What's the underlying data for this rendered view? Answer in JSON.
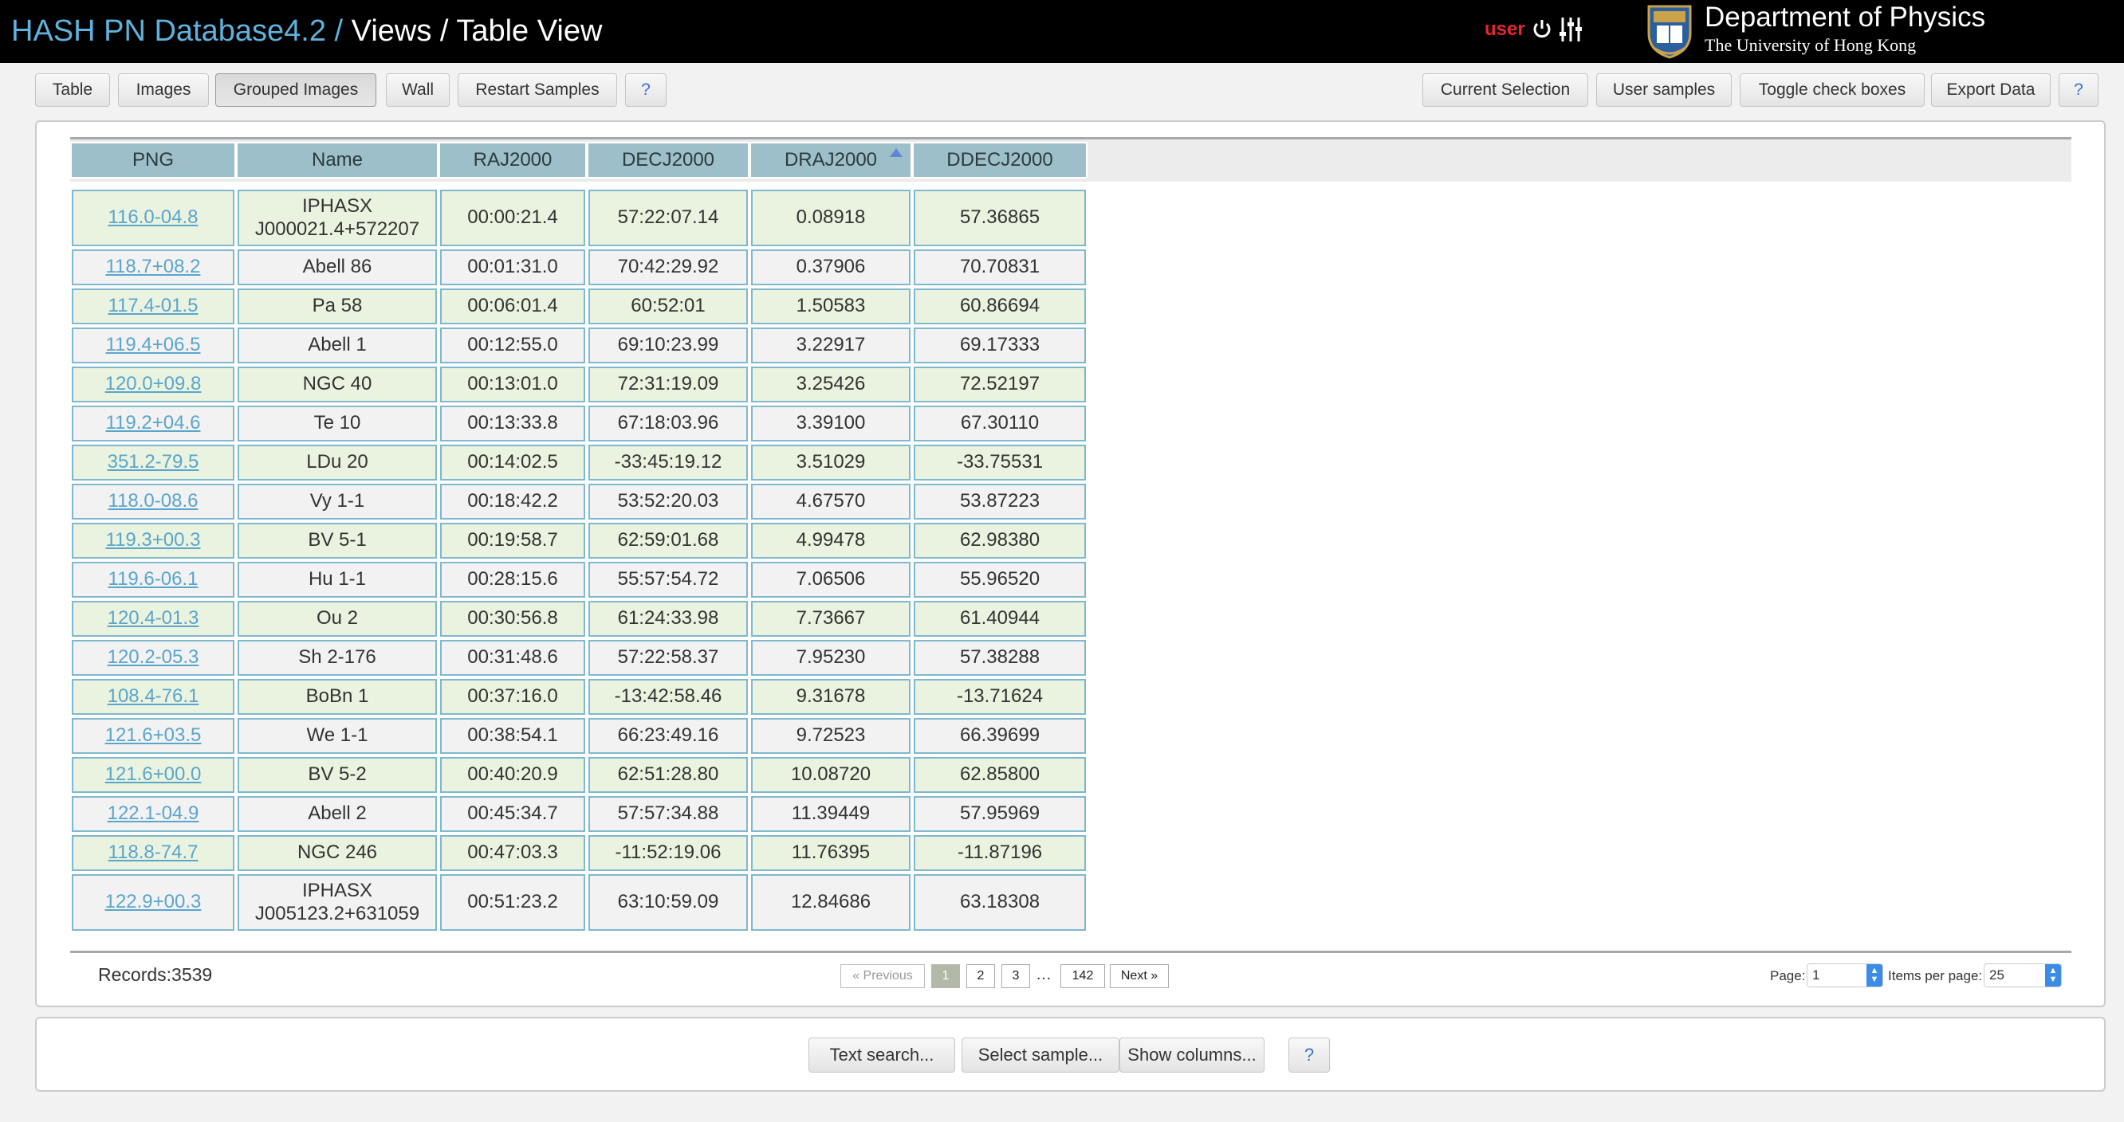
{
  "header": {
    "title_prefix": "HASH PN Database4.2 /",
    "title_suffix": "Views / Table View",
    "user_label": "user",
    "dept_name": "Department of Physics",
    "uni_name": "The University of Hong Kong"
  },
  "toolbar_left": [
    "Table",
    "Images",
    "Grouped Images",
    "Wall",
    "Restart Samples",
    "?"
  ],
  "active_view": "Grouped Images",
  "toolbar_right": [
    "Current Selection",
    "User samples",
    "Toggle check boxes",
    "Export Data",
    "?"
  ],
  "table": {
    "columns": [
      "PNG",
      "Name",
      "RAJ2000",
      "DECJ2000",
      "DRAJ2000",
      "DDECJ2000"
    ],
    "sorted_column": "DRAJ2000",
    "sort_direction": "ascending",
    "rows": [
      [
        "116.0-04.8",
        "IPHASX\nJ000021.4+572207",
        "00:00:21.4",
        "57:22:07.14",
        "0.08918",
        "57.36865"
      ],
      [
        "118.7+08.2",
        "Abell 86",
        "00:01:31.0",
        "70:42:29.92",
        "0.37906",
        "70.70831"
      ],
      [
        "117.4-01.5",
        "Pa 58",
        "00:06:01.4",
        "60:52:01",
        "1.50583",
        "60.86694"
      ],
      [
        "119.4+06.5",
        "Abell 1",
        "00:12:55.0",
        "69:10:23.99",
        "3.22917",
        "69.17333"
      ],
      [
        "120.0+09.8",
        "NGC 40",
        "00:13:01.0",
        "72:31:19.09",
        "3.25426",
        "72.52197"
      ],
      [
        "119.2+04.6",
        "Te 10",
        "00:13:33.8",
        "67:18:03.96",
        "3.39100",
        "67.30110"
      ],
      [
        "351.2-79.5",
        "LDu 20",
        "00:14:02.5",
        "-33:45:19.12",
        "3.51029",
        "-33.75531"
      ],
      [
        "118.0-08.6",
        "Vy 1-1",
        "00:18:42.2",
        "53:52:20.03",
        "4.67570",
        "53.87223"
      ],
      [
        "119.3+00.3",
        "BV 5-1",
        "00:19:58.7",
        "62:59:01.68",
        "4.99478",
        "62.98380"
      ],
      [
        "119.6-06.1",
        "Hu 1-1",
        "00:28:15.6",
        "55:57:54.72",
        "7.06506",
        "55.96520"
      ],
      [
        "120.4-01.3",
        "Ou 2",
        "00:30:56.8",
        "61:24:33.98",
        "7.73667",
        "61.40944"
      ],
      [
        "120.2-05.3",
        "Sh 2-176",
        "00:31:48.6",
        "57:22:58.37",
        "7.95230",
        "57.38288"
      ],
      [
        "108.4-76.1",
        "BoBn 1",
        "00:37:16.0",
        "-13:42:58.46",
        "9.31678",
        "-13.71624"
      ],
      [
        "121.6+03.5",
        "We 1-1",
        "00:38:54.1",
        "66:23:49.16",
        "9.72523",
        "66.39699"
      ],
      [
        "121.6+00.0",
        "BV 5-2",
        "00:40:20.9",
        "62:51:28.80",
        "10.08720",
        "62.85800"
      ],
      [
        "122.1-04.9",
        "Abell 2",
        "00:45:34.7",
        "57:57:34.88",
        "11.39449",
        "57.95969"
      ],
      [
        "118.8-74.7",
        "NGC 246",
        "00:47:03.3",
        "-11:52:19.06",
        "11.76395",
        "-11.87196"
      ],
      [
        "122.9+00.3",
        "IPHASX\nJ005123.2+631059",
        "00:51:23.2",
        "63:10:59.09",
        "12.84686",
        "63.18308"
      ]
    ]
  },
  "footer": {
    "records": "Records:3539",
    "prev": "« Previous",
    "pages": [
      "1",
      "2",
      "3"
    ],
    "current_page": "1",
    "ellipsis": "…",
    "last_page": "142",
    "next": "Next »",
    "page_label": "Page:",
    "page_value": "1",
    "items_label": "Items per page:",
    "items_value": "25"
  },
  "search_buttons": [
    "Text search...",
    "Select sample...",
    "Show columns...",
    "?"
  ],
  "colors": {
    "header_bg": "#000000",
    "title_blue": "#5fb2de",
    "user_red": "#e8272d",
    "column_header": "#9dbfc9",
    "odd_row": "#eaf3df",
    "even_row": "#f2f2f2",
    "cell_border": "#7fb8cf",
    "link": "#5aa5cc"
  },
  "icons": [
    "power-icon",
    "settings-sliders-icon",
    "university-crest-icon",
    "sort-ascending-icon",
    "spinner-arrows-icon"
  ]
}
